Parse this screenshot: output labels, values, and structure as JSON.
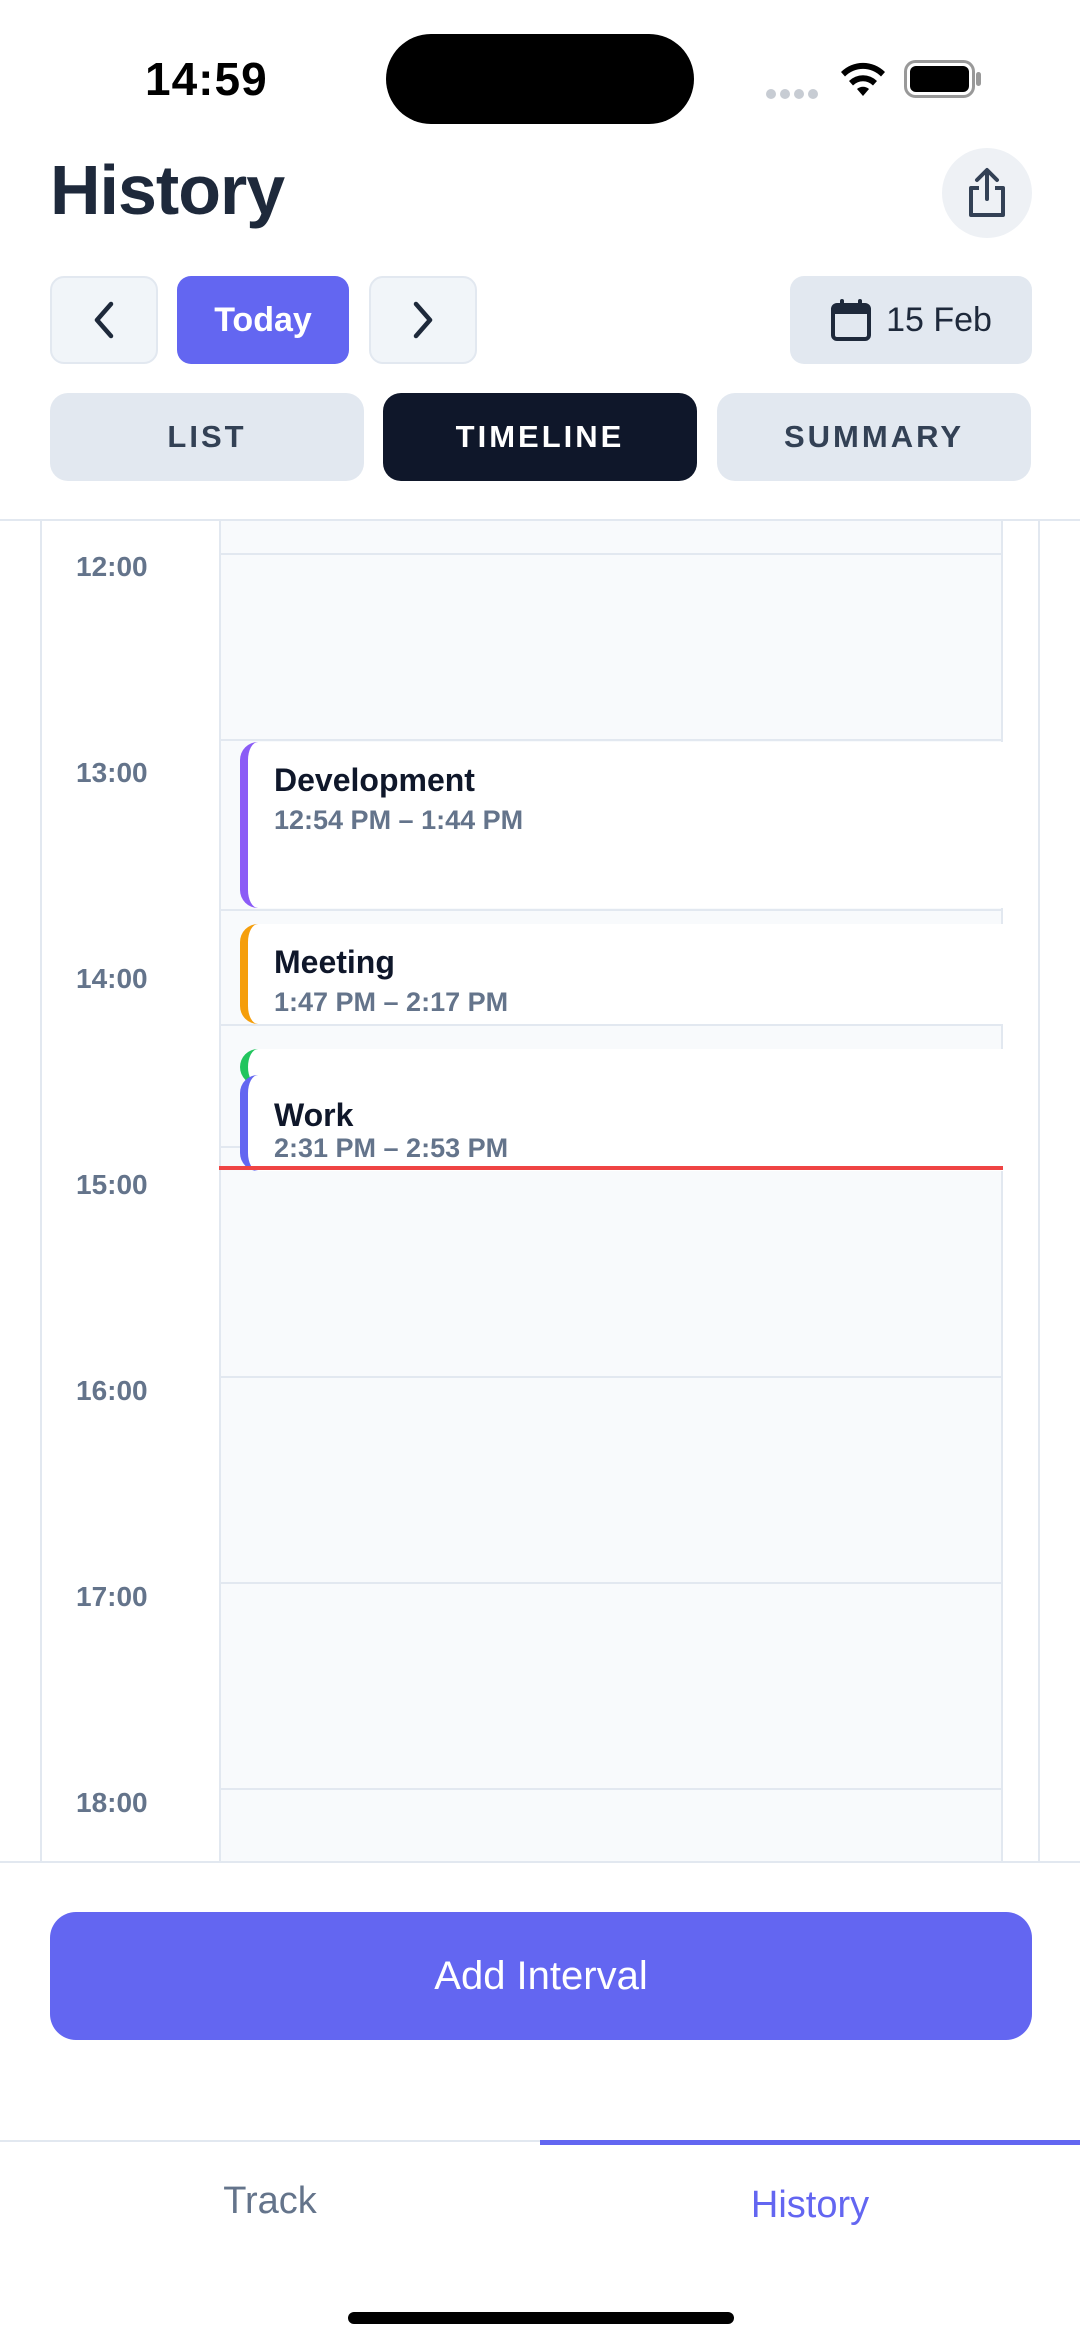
{
  "status_bar": {
    "time": "14:59"
  },
  "header": {
    "title": "History",
    "share_icon": "share-icon"
  },
  "nav": {
    "today_label": "Today",
    "date_label": "15 Feb",
    "prev_icon": "chevron-left-icon",
    "next_icon": "chevron-right-icon",
    "calendar_icon": "calendar-icon"
  },
  "tabs": [
    {
      "label": "LIST",
      "active": false
    },
    {
      "label": "TIMELINE",
      "active": true
    },
    {
      "label": "SUMMARY",
      "active": false
    }
  ],
  "timeline": {
    "hours": [
      "12:00",
      "13:00",
      "14:00",
      "15:00",
      "16:00",
      "17:00",
      "18:00"
    ],
    "events": [
      {
        "name": "Development",
        "time": "12:54 PM – 1:44 PM",
        "color": "#8b5cf6"
      },
      {
        "name": "Meeting",
        "time": "1:47 PM – 2:17 PM",
        "color": "#f59e0b"
      },
      {
        "name": "",
        "time": "",
        "color": "#22c55e"
      },
      {
        "name": "Work",
        "time": "2:31 PM – 2:53 PM",
        "color": "#6366f1"
      }
    ],
    "now_color": "#ef4444"
  },
  "actions": {
    "add_label": "Add Interval"
  },
  "tabbar": {
    "track_label": "Track",
    "history_label": "History",
    "active": "History"
  },
  "colors": {
    "accent": "#6366f1",
    "dark": "#0f172a"
  }
}
